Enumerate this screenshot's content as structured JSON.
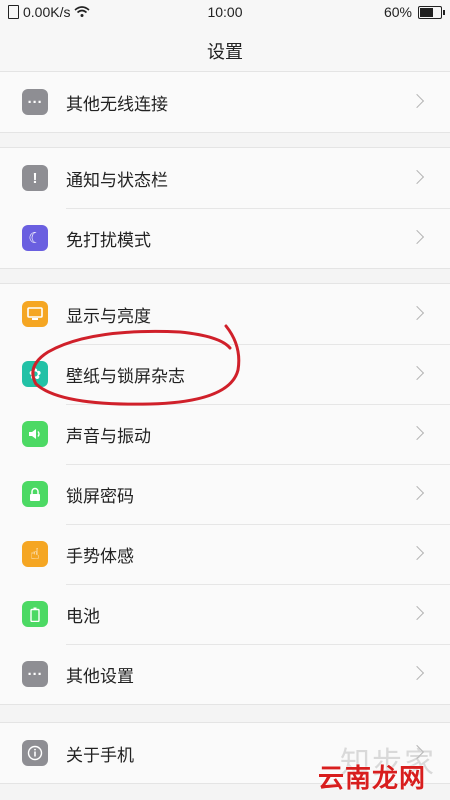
{
  "status_bar": {
    "speed": "0.00K/s",
    "time": "10:00",
    "battery": "60%"
  },
  "header": {
    "title": "设置"
  },
  "colors": {
    "gray": "#8e8e93",
    "purple": "#6a5fe0",
    "orange": "#f5a623",
    "teal": "#22c1a6",
    "green": "#4cd964",
    "annotation": "#d0202a"
  },
  "groups": [
    {
      "items": [
        {
          "label": "其他无线连接",
          "icon": "more-dots-icon"
        }
      ]
    },
    {
      "items": [
        {
          "label": "通知与状态栏",
          "icon": "notification-icon"
        },
        {
          "label": "免打扰模式",
          "icon": "moon-icon"
        }
      ]
    },
    {
      "items": [
        {
          "label": "显示与亮度",
          "icon": "display-icon"
        },
        {
          "label": "壁纸与锁屏杂志",
          "icon": "wallpaper-icon"
        },
        {
          "label": "声音与振动",
          "icon": "speaker-icon"
        },
        {
          "label": "锁屏密码",
          "icon": "lock-icon"
        },
        {
          "label": "手势体感",
          "icon": "gesture-hand-icon"
        },
        {
          "label": "电池",
          "icon": "battery-icon"
        },
        {
          "label": "其他设置",
          "icon": "more-dots-icon"
        }
      ]
    },
    {
      "items": [
        {
          "label": "关于手机",
          "icon": "info-icon"
        }
      ]
    }
  ],
  "watermark": {
    "line1": "知步家",
    "line2": "云南龙网"
  }
}
